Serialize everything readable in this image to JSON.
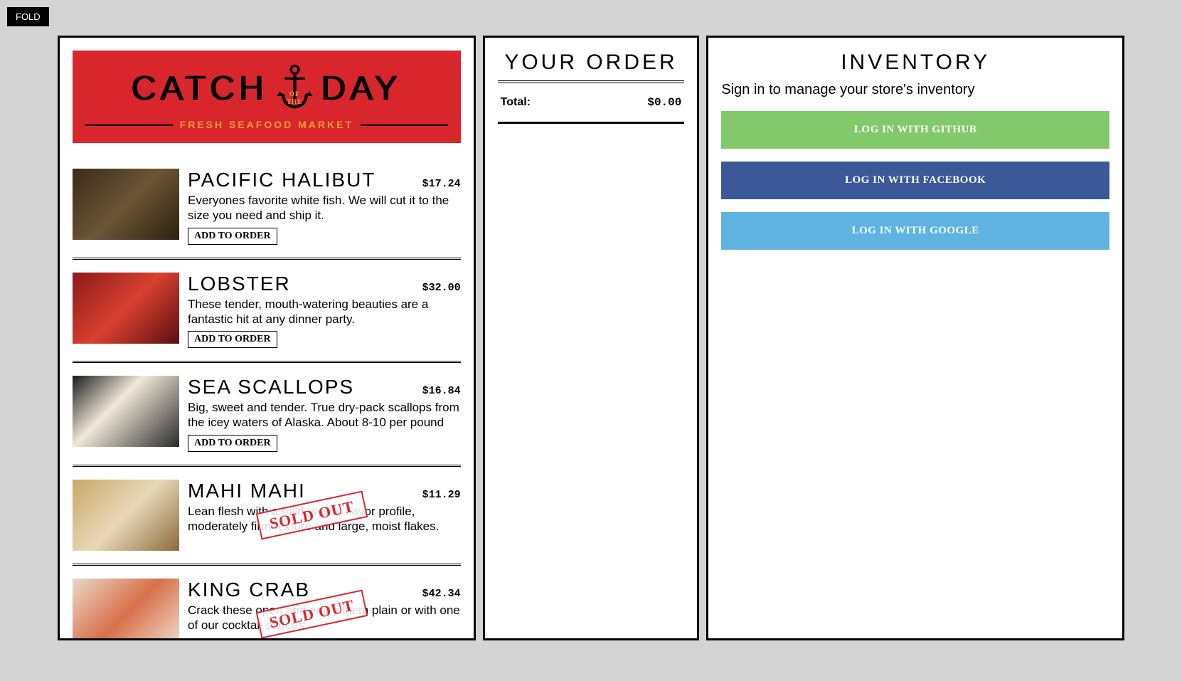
{
  "fold_label": "FOLD",
  "header": {
    "word1": "CATCH",
    "word2": "DAY",
    "of_the": "OF\nTHE",
    "subtitle": "FRESH SEAFOOD MARKET"
  },
  "fishes": [
    {
      "name": "PACIFIC HALIBUT",
      "price": "$17.24",
      "desc": "Everyones favorite white fish. We will cut it to the size you need and ship it.",
      "available": true,
      "img_class": "img-halibut"
    },
    {
      "name": "LOBSTER",
      "price": "$32.00",
      "desc": "These tender, mouth-watering beauties are a fantastic hit at any dinner party.",
      "available": true,
      "img_class": "img-lobster"
    },
    {
      "name": "SEA SCALLOPS",
      "price": "$16.84",
      "desc": "Big, sweet and tender. True dry-pack scallops from the icey waters of Alaska. About 8-10 per pound",
      "available": true,
      "img_class": "img-scallops"
    },
    {
      "name": "MAHI MAHI",
      "price": "$11.29",
      "desc": "Lean flesh with a mild, sweet flavor profile, moderately firm texture and large, moist flakes.",
      "available": false,
      "img_class": "img-mahi"
    },
    {
      "name": "KING CRAB",
      "price": "$42.34",
      "desc": "Crack these open and enjoy them plain or with one of our cocktail sauces",
      "available": false,
      "img_class": "img-crab"
    }
  ],
  "add_btn_label": "ADD TO ORDER",
  "sold_out_label": "SOLD OUT",
  "order": {
    "title": "YOUR ORDER",
    "total_label": "Total:",
    "total_value": "$0.00"
  },
  "inventory": {
    "title": "INVENTORY",
    "signin_prompt": "Sign in to manage your store's inventory",
    "github_label": "LOG IN WITH GITHUB",
    "facebook_label": "LOG IN WITH FACEBOOK",
    "google_label": "LOG IN WITH GOOGLE"
  }
}
